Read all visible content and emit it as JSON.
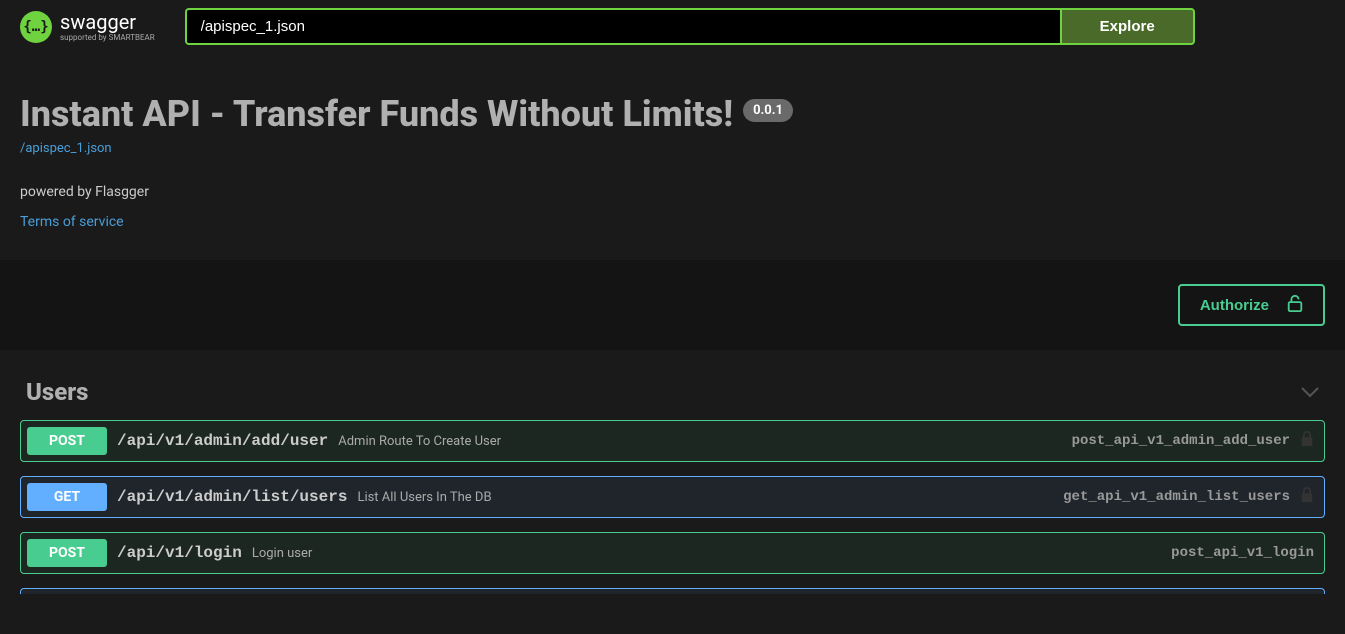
{
  "topbar": {
    "logo_main": "swagger",
    "logo_sub": "supported by SMARTBEAR",
    "spec_input": "/apispec_1.json",
    "explore_label": "Explore"
  },
  "info": {
    "title": "Instant API - Transfer Funds Without Limits!",
    "version": "0.0.1",
    "spec_link": "/apispec_1.json",
    "powered_by": "powered by Flasgger",
    "tos": "Terms of service"
  },
  "authorize": {
    "label": "Authorize"
  },
  "tag": {
    "name": "Users"
  },
  "ops": [
    {
      "method": "POST",
      "method_class": "post",
      "path": "/api/v1/admin/add/user",
      "summary": "Admin Route To Create User",
      "op_id": "post_api_v1_admin_add_user",
      "locked": true
    },
    {
      "method": "GET",
      "method_class": "get",
      "path": "/api/v1/admin/list/users",
      "summary": "List All Users In The DB",
      "op_id": "get_api_v1_admin_list_users",
      "locked": true
    },
    {
      "method": "POST",
      "method_class": "post",
      "path": "/api/v1/login",
      "summary": "Login user",
      "op_id": "post_api_v1_login",
      "locked": false
    }
  ]
}
